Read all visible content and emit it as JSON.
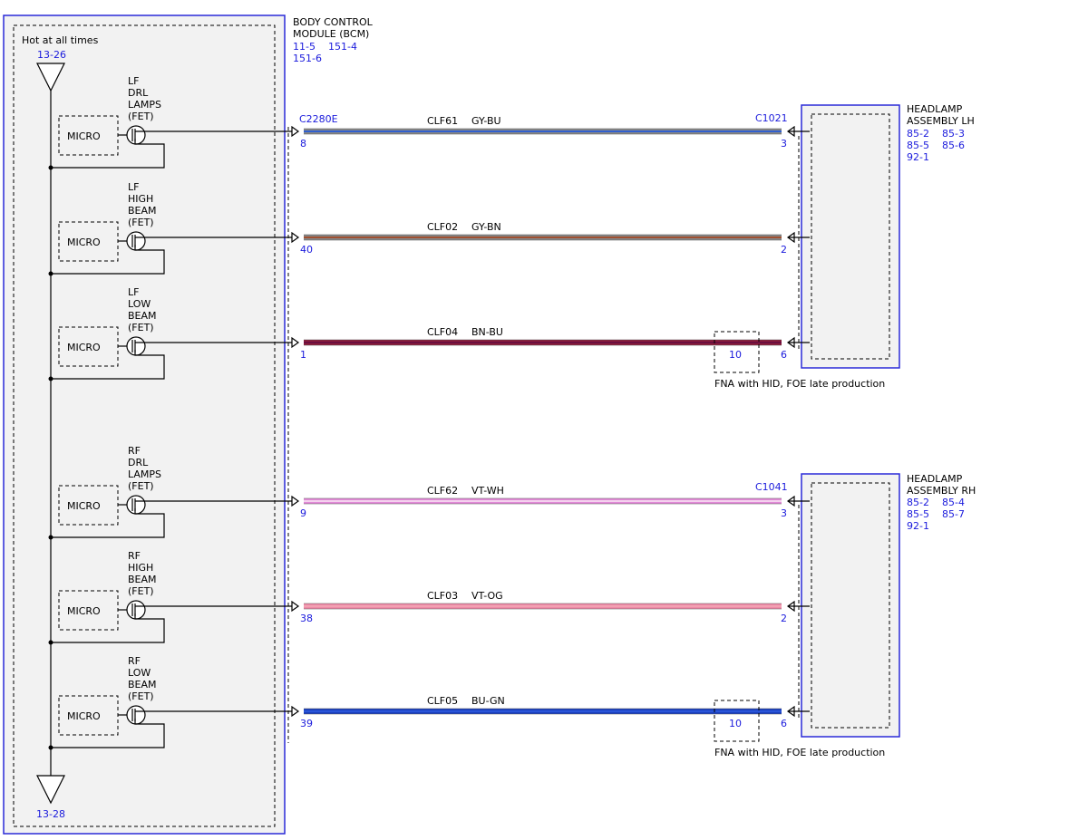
{
  "bcm": {
    "title_line1": "BODY CONTROL",
    "title_line2": "MODULE (BCM)",
    "refs_line1": [
      "11-5",
      "151-4"
    ],
    "refs_line2": [
      "151-6"
    ],
    "hot_label": "Hot at all times",
    "top_ref": "13-26",
    "top_node": "CC",
    "bottom_node": "DD",
    "bottom_ref": "13-28",
    "connector": "C2280E"
  },
  "micro_label": "MICRO",
  "circuits": [
    {
      "side": "LF",
      "func_lines": [
        "LF",
        "DRL",
        "LAMPS",
        "(FET)"
      ],
      "wire": "CLF61",
      "color_code": "GY-BU",
      "bcm_pin": "8",
      "lamp_pin": "3",
      "colors": [
        "#888888",
        "#3060d0",
        "#888888"
      ]
    },
    {
      "side": "LF",
      "func_lines": [
        "LF",
        "HIGH",
        "BEAM",
        "(FET)"
      ],
      "wire": "CLF02",
      "color_code": "GY-BN",
      "bcm_pin": "40",
      "lamp_pin": "2",
      "colors": [
        "#888888",
        "#a05030",
        "#888888"
      ]
    },
    {
      "side": "LF",
      "func_lines": [
        "LF",
        "LOW",
        "BEAM",
        "(FET)"
      ],
      "wire": "CLF04",
      "color_code": "BN-BU",
      "bcm_pin": "1",
      "lamp_pin": "6",
      "colors": [
        "#8b1a3a",
        "#6a0f3f",
        "#8b1a3a"
      ],
      "inline": {
        "pin": "10",
        "note": "FNA with HID, FOE late production"
      }
    },
    {
      "side": "RF",
      "func_lines": [
        "RF",
        "DRL",
        "LAMPS",
        "(FET)"
      ],
      "wire": "CLF62",
      "color_code": "VT-WH",
      "bcm_pin": "9",
      "lamp_pin": "3",
      "colors": [
        "#e38ad8",
        "#f4d2ee",
        "#e38ad8"
      ]
    },
    {
      "side": "RF",
      "func_lines": [
        "RF",
        "HIGH",
        "BEAM",
        "(FET)"
      ],
      "wire": "CLF03",
      "color_code": "VT-OG",
      "bcm_pin": "38",
      "lamp_pin": "2",
      "colors": [
        "#ef8aa8",
        "#f2a2b2",
        "#ef8aa8"
      ]
    },
    {
      "side": "RF",
      "func_lines": [
        "RF",
        "LOW",
        "BEAM",
        "(FET)"
      ],
      "wire": "CLF05",
      "color_code": "BU-GN",
      "bcm_pin": "39",
      "lamp_pin": "6",
      "colors": [
        "#1a3fbf",
        "#2a55d8",
        "#1a3fbf"
      ],
      "inline": {
        "pin": "10",
        "note": "FNA with HID, FOE late production"
      }
    }
  ],
  "headlamps": [
    {
      "title_line1": "HEADLAMP",
      "title_line2": "ASSEMBLY LH",
      "refs": [
        [
          "85-2",
          "85-3"
        ],
        [
          "85-5",
          "85-6"
        ],
        [
          "92-1"
        ]
      ],
      "connector": "C1021"
    },
    {
      "title_line1": "HEADLAMP",
      "title_line2": "ASSEMBLY RH",
      "refs": [
        [
          "85-2",
          "85-4"
        ],
        [
          "85-5",
          "85-7"
        ],
        [
          "92-1"
        ]
      ],
      "connector": "C1041"
    }
  ],
  "colors": {
    "module_border": "#2a2ad8",
    "module_fill": "#f2f2f2",
    "ref_text": "#1a1adc"
  }
}
